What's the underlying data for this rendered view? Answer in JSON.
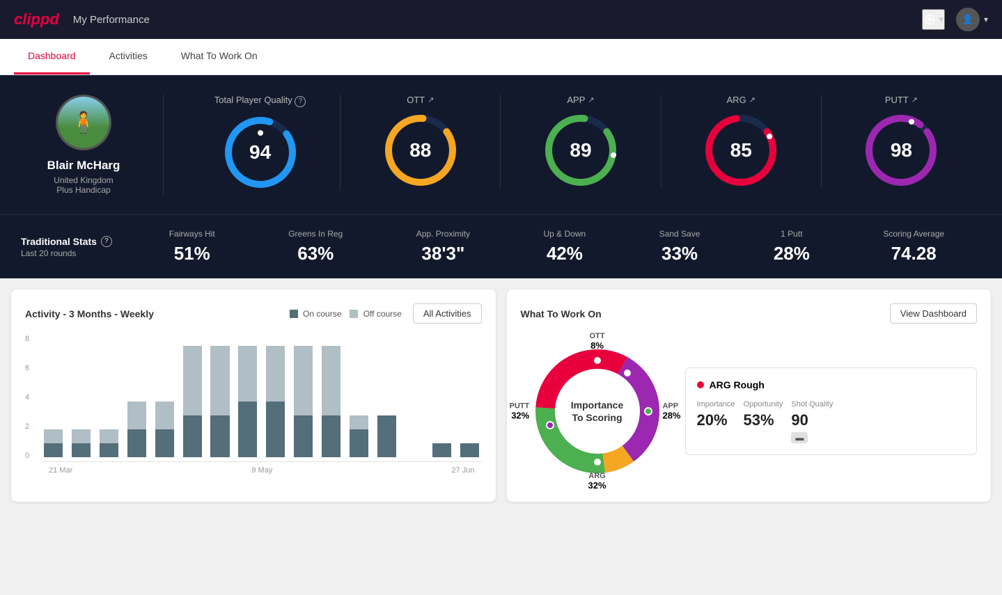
{
  "app": {
    "logo": "clippd",
    "header_title": "My Performance"
  },
  "tabs": [
    {
      "id": "dashboard",
      "label": "Dashboard",
      "active": true
    },
    {
      "id": "activities",
      "label": "Activities",
      "active": false
    },
    {
      "id": "what-to-work-on",
      "label": "What To Work On",
      "active": false
    }
  ],
  "player": {
    "name": "Blair McHarg",
    "country": "United Kingdom",
    "handicap": "Plus Handicap"
  },
  "scores": {
    "tpq_label": "Total Player Quality",
    "tpq_value": "94",
    "tpq_color": "#2196F3",
    "cards": [
      {
        "label": "OTT",
        "value": "88",
        "color": "#F5A623"
      },
      {
        "label": "APP",
        "value": "89",
        "color": "#4CAF50"
      },
      {
        "label": "ARG",
        "value": "85",
        "color": "#e8003d"
      },
      {
        "label": "PUTT",
        "value": "98",
        "color": "#9C27B0"
      }
    ]
  },
  "traditional_stats": {
    "title": "Traditional Stats",
    "period": "Last 20 rounds",
    "items": [
      {
        "label": "Fairways Hit",
        "value": "51%"
      },
      {
        "label": "Greens In Reg",
        "value": "63%"
      },
      {
        "label": "App. Proximity",
        "value": "38'3\""
      },
      {
        "label": "Up & Down",
        "value": "42%"
      },
      {
        "label": "Sand Save",
        "value": "33%"
      },
      {
        "label": "1 Putt",
        "value": "28%"
      },
      {
        "label": "Scoring Average",
        "value": "74.28"
      }
    ]
  },
  "activity_chart": {
    "title": "Activity - 3 Months - Weekly",
    "legend_on": "On course",
    "legend_off": "Off course",
    "all_activities_btn": "All Activities",
    "y_labels": [
      "8",
      "6",
      "4",
      "2",
      "0"
    ],
    "x_labels": [
      "21 Mar",
      "9 May",
      "27 Jun"
    ],
    "bars": [
      {
        "on": 1,
        "off": 1
      },
      {
        "on": 1,
        "off": 1
      },
      {
        "on": 1,
        "off": 1
      },
      {
        "on": 2,
        "off": 2
      },
      {
        "on": 2,
        "off": 2
      },
      {
        "on": 3,
        "off": 5
      },
      {
        "on": 3,
        "off": 5
      },
      {
        "on": 4,
        "off": 4
      },
      {
        "on": 4,
        "off": 4
      },
      {
        "on": 3,
        "off": 5
      },
      {
        "on": 3,
        "off": 5
      },
      {
        "on": 2,
        "off": 1
      },
      {
        "on": 3,
        "off": 0
      },
      {
        "on": 0,
        "off": 0
      },
      {
        "on": 1,
        "off": 0
      },
      {
        "on": 1,
        "off": 0
      }
    ]
  },
  "what_to_work_on": {
    "title": "What To Work On",
    "view_dashboard_btn": "View Dashboard",
    "donut_center_line1": "Importance",
    "donut_center_line2": "To Scoring",
    "segments": [
      {
        "label": "OTT",
        "pct": "8%",
        "color": "#F5A623"
      },
      {
        "label": "APP",
        "pct": "28%",
        "color": "#4CAF50"
      },
      {
        "label": "ARG",
        "pct": "32%",
        "color": "#e8003d"
      },
      {
        "label": "PUTT",
        "pct": "32%",
        "color": "#9C27B0"
      }
    ],
    "info_card": {
      "title": "ARG Rough",
      "dot_color": "#e8003d",
      "metrics": [
        {
          "label": "Importance",
          "value": "20%"
        },
        {
          "label": "Opportunity",
          "value": "53%"
        },
        {
          "label": "Shot Quality",
          "value": "90",
          "badge": ""
        }
      ]
    }
  }
}
